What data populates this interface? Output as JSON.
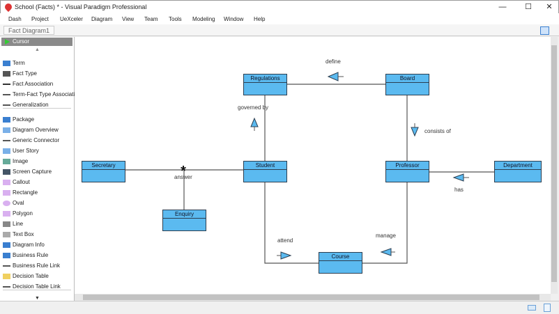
{
  "window": {
    "title": "School (Facts) * - Visual Paradigm Professional",
    "minimize": "—",
    "maximize": "☐",
    "close": "✕"
  },
  "menu": [
    "Dash",
    "Project",
    "UeXceler",
    "Diagram",
    "View",
    "Team",
    "Tools",
    "Modeling",
    "Window",
    "Help"
  ],
  "breadcrumb": "Fact Diagram1",
  "palette": {
    "cursor": "Cursor",
    "items": [
      "Term",
      "Fact Type",
      "Fact Association",
      "Term-Fact Type Association",
      "Generalization",
      "Package",
      "Diagram Overview",
      "Generic Connector",
      "User Story",
      "Image",
      "Screen Capture",
      "Callout",
      "Rectangle",
      "Oval",
      "Polygon",
      "Line",
      "Text Box",
      "Diagram Info",
      "Business Rule",
      "Business Rule Link",
      "Decision Table",
      "Decision Table Link"
    ]
  },
  "diagram": {
    "terms": [
      "Regulations",
      "Board",
      "Secretary",
      "Student",
      "Professor",
      "Department",
      "Enquiry",
      "Course"
    ],
    "facts": [
      "define",
      "governed by",
      "consists of",
      "answer",
      "has",
      "attend",
      "manage"
    ],
    "colors": {
      "term_fill": "#5bbaf0",
      "line": "#555555"
    }
  }
}
